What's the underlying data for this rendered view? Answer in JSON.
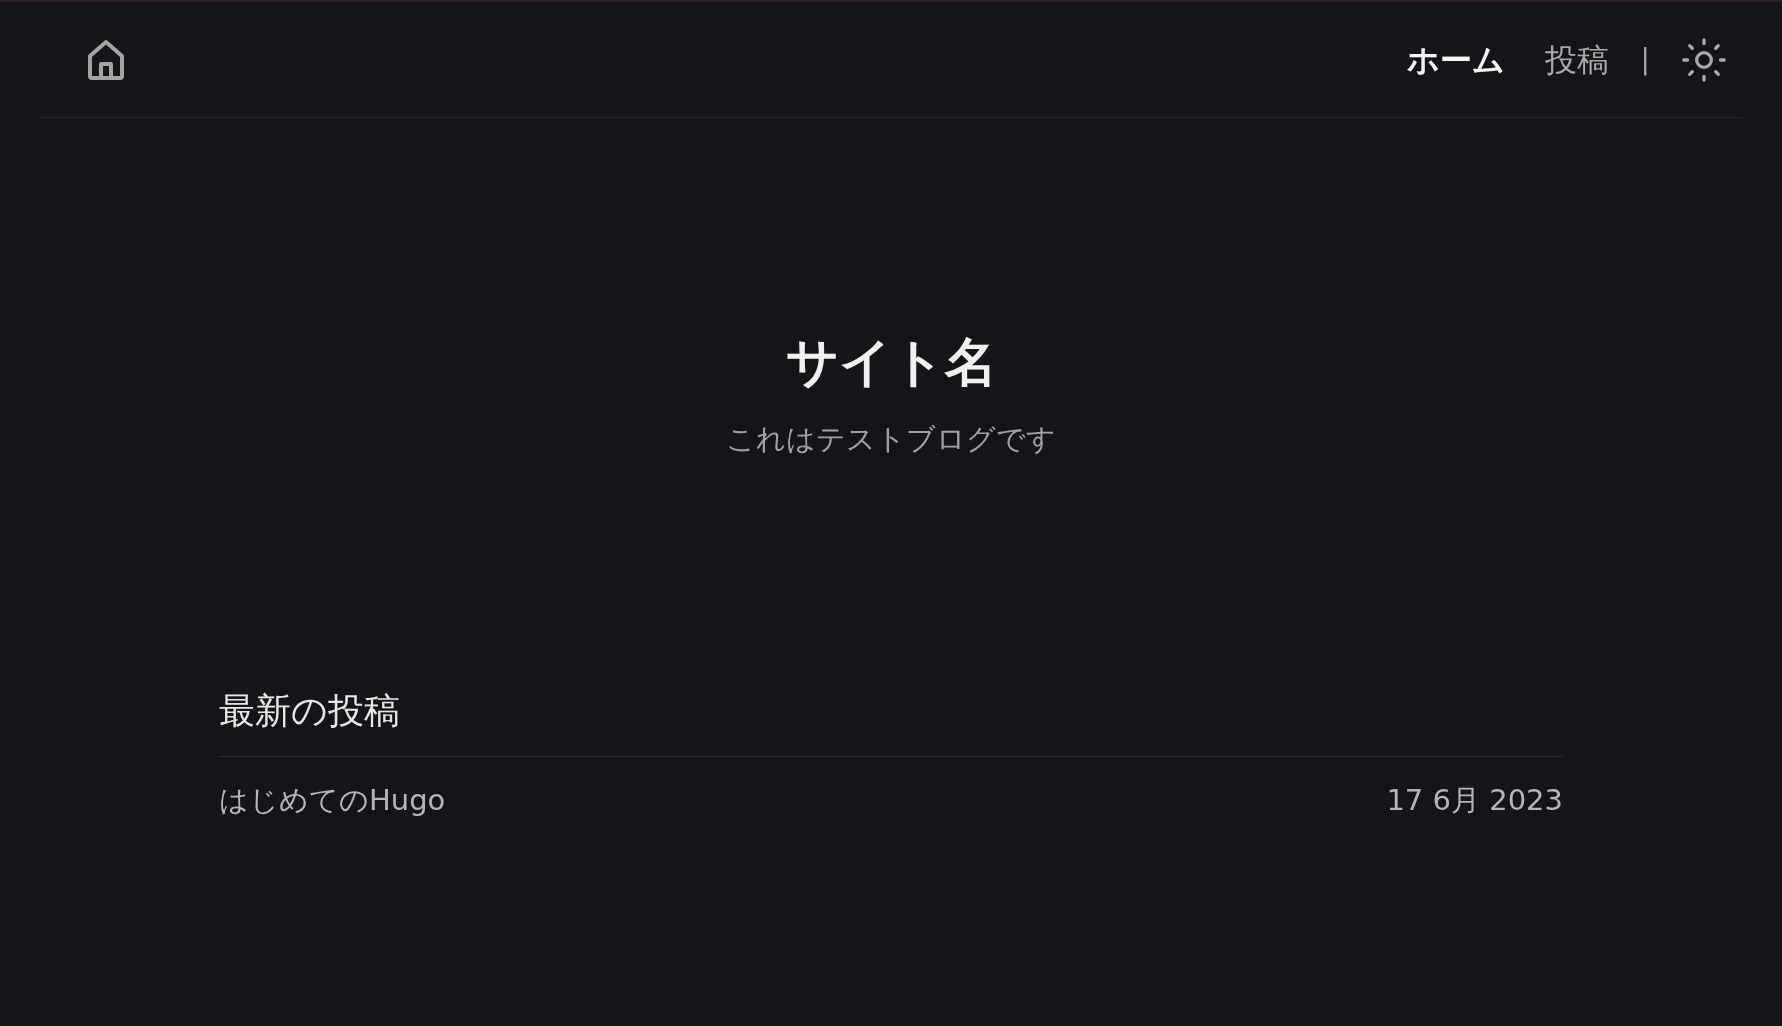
{
  "nav": {
    "items": [
      {
        "label": "ホーム",
        "selected": true
      },
      {
        "label": "投稿",
        "selected": false
      }
    ],
    "separator": "|"
  },
  "hero": {
    "title": "サイト名",
    "subtitle": "これはテストブログです"
  },
  "recent": {
    "heading": "最新の投稿",
    "posts": [
      {
        "title": "はじめてのHugo",
        "date": "17 6月 2023"
      }
    ]
  }
}
